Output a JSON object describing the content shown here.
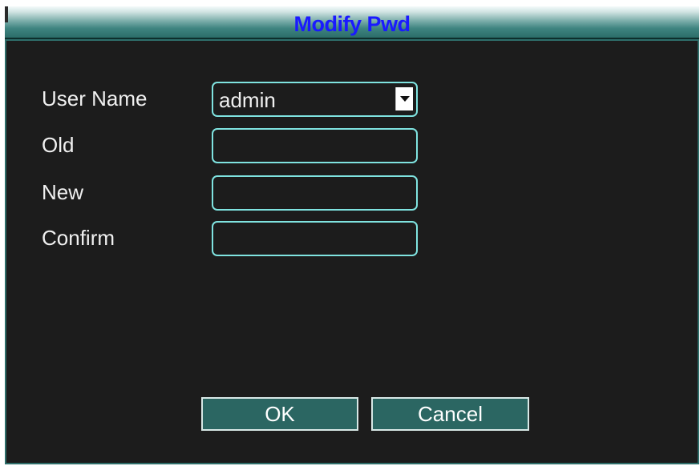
{
  "window": {
    "title": "Modify Pwd"
  },
  "form": {
    "user_name_label": "User Name",
    "user_name_value": "admin",
    "old_label": "Old",
    "old_value": "",
    "new_label": "New",
    "new_value": "",
    "confirm_label": "Confirm",
    "confirm_value": ""
  },
  "buttons": {
    "ok_label": "OK",
    "cancel_label": "Cancel"
  },
  "icons": {
    "dropdown": "chevron-down-icon"
  },
  "colors": {
    "title_text": "#1a1aff",
    "field_border": "#7fe3e0",
    "button_bg": "#2b6662",
    "dialog_bg": "#1c1c1c"
  }
}
